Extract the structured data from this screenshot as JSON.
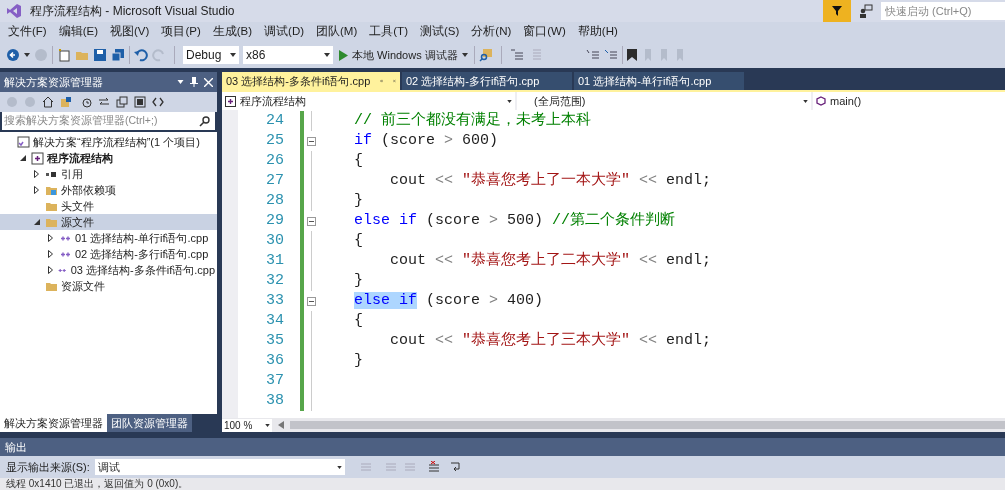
{
  "window": {
    "title": "程序流程结构 - Microsoft Visual Studio"
  },
  "quick_launch": {
    "placeholder": "快速启动 (Ctrl+Q)"
  },
  "menu": [
    "文件(F)",
    "编辑(E)",
    "视图(V)",
    "项目(P)",
    "生成(B)",
    "调试(D)",
    "团队(M)",
    "工具(T)",
    "测试(S)",
    "分析(N)",
    "窗口(W)",
    "帮助(H)"
  ],
  "toolbar": {
    "configuration": "Debug",
    "platform": "x86",
    "run": "本地 Windows 调试器"
  },
  "solution_explorer": {
    "title": "解决方案资源管理器",
    "search": {
      "placeholder": "搜索解决方案资源管理器(Ctrl+;)"
    },
    "tree": [
      {
        "label": "解决方案“程序流程结构”(1 个项目)",
        "kind": "solution",
        "selected": false,
        "children": [
          {
            "label": "程序流程结构",
            "kind": "project",
            "expanded": true,
            "selected": false,
            "bold": true,
            "children": [
              {
                "label": "引用",
                "kind": "references",
                "expanded": false,
                "selected": false
              },
              {
                "label": "外部依赖项",
                "kind": "external",
                "expanded": false,
                "selected": false
              },
              {
                "label": "头文件",
                "kind": "folder",
                "selected": false
              },
              {
                "label": "源文件",
                "kind": "folder",
                "expanded": true,
                "selected": true,
                "children": [
                  {
                    "label": "01 选择结构-单行if语句.cpp",
                    "kind": "cpp",
                    "expanded": false,
                    "selected": false
                  },
                  {
                    "label": "02 选择结构-多行if语句.cpp",
                    "kind": "cpp",
                    "expanded": false,
                    "selected": false
                  },
                  {
                    "label": "03 选择结构-多条件if语句.cpp",
                    "kind": "cpp",
                    "expanded": false,
                    "selected": false
                  }
                ]
              },
              {
                "label": "资源文件",
                "kind": "folder",
                "selected": false
              }
            ]
          }
        ]
      }
    ],
    "bottom_tabs": [
      {
        "label": "解决方案资源管理器",
        "selected": true
      },
      {
        "label": "团队资源管理器",
        "selected": false
      }
    ]
  },
  "editor": {
    "tabs": [
      {
        "label": "03 选择结构-多条件if语句.cpp",
        "selected": true
      },
      {
        "label": "02 选择结构-多行if语句.cpp",
        "selected": false
      },
      {
        "label": "01 选择结构-单行if语句.cpp",
        "selected": false
      }
    ],
    "nav": {
      "project": "程序流程结构",
      "scope": "(全局范围)",
      "member": "main()"
    },
    "zoom": "100 %",
    "lines": [
      {
        "number": "24",
        "foldable": false,
        "tokens": [
          {
            "kind": "comment",
            "text": "    // 前三个都没有满足，未考上本科"
          }
        ]
      },
      {
        "number": "25",
        "foldable": true,
        "tokens": [
          {
            "kind": "keyword",
            "text": "    if"
          },
          {
            "kind": "plain",
            "text": " (score "
          },
          {
            "kind": "operator",
            "text": ">"
          },
          {
            "kind": "plain",
            "text": " 600)"
          }
        ]
      },
      {
        "number": "26",
        "foldable": false,
        "tokens": [
          {
            "kind": "plain",
            "text": "    {"
          }
        ]
      },
      {
        "number": "27",
        "foldable": false,
        "tokens": [
          {
            "kind": "plain",
            "text": "        cout "
          },
          {
            "kind": "operator",
            "text": "<<"
          },
          {
            "kind": "string",
            "text": " \"恭喜您考上了一本大学\""
          },
          {
            "kind": "operator",
            "text": " <<"
          },
          {
            "kind": "plain",
            "text": " endl;"
          }
        ]
      },
      {
        "number": "28",
        "foldable": false,
        "tokens": [
          {
            "kind": "plain",
            "text": "    }"
          }
        ]
      },
      {
        "number": "29",
        "foldable": true,
        "tokens": [
          {
            "kind": "keyword",
            "text": "    else if"
          },
          {
            "kind": "plain",
            "text": " (score "
          },
          {
            "kind": "operator",
            "text": ">"
          },
          {
            "kind": "plain",
            "text": " 500) "
          },
          {
            "kind": "comment",
            "text": "//第二个条件判断"
          }
        ]
      },
      {
        "number": "30",
        "foldable": false,
        "tokens": [
          {
            "kind": "plain",
            "text": "    {"
          }
        ]
      },
      {
        "number": "31",
        "foldable": false,
        "tokens": [
          {
            "kind": "plain",
            "text": "        cout "
          },
          {
            "kind": "operator",
            "text": "<<"
          },
          {
            "kind": "string",
            "text": " \"恭喜您考上了二本大学\""
          },
          {
            "kind": "operator",
            "text": " <<"
          },
          {
            "kind": "plain",
            "text": " endl;"
          }
        ]
      },
      {
        "number": "32",
        "foldable": false,
        "tokens": [
          {
            "kind": "plain",
            "text": "    }"
          }
        ]
      },
      {
        "number": "33",
        "foldable": true,
        "tokens": [
          {
            "kind": "keyword",
            "text": "    else if",
            "selected": true
          },
          {
            "kind": "plain",
            "text": " (score "
          },
          {
            "kind": "operator",
            "text": ">"
          },
          {
            "kind": "plain",
            "text": " 400)"
          }
        ]
      },
      {
        "number": "34",
        "foldable": false,
        "tokens": [
          {
            "kind": "plain",
            "text": "    {"
          }
        ]
      },
      {
        "number": "35",
        "foldable": false,
        "tokens": [
          {
            "kind": "plain",
            "text": "        cout "
          },
          {
            "kind": "operator",
            "text": "<<"
          },
          {
            "kind": "string",
            "text": " \"恭喜您考上了三本大学\""
          },
          {
            "kind": "operator",
            "text": " <<"
          },
          {
            "kind": "plain",
            "text": " endl;"
          }
        ]
      },
      {
        "number": "36",
        "foldable": false,
        "tokens": [
          {
            "kind": "plain",
            "text": "    }"
          }
        ]
      },
      {
        "number": "37",
        "foldable": false
      },
      {
        "number": "38",
        "foldable": false
      }
    ]
  },
  "output": {
    "title": "输出",
    "source_label": "显示输出来源(S):",
    "source": "调试",
    "text": "线程 0x1410 已退出，返回值为 0 (0x0)。"
  }
}
